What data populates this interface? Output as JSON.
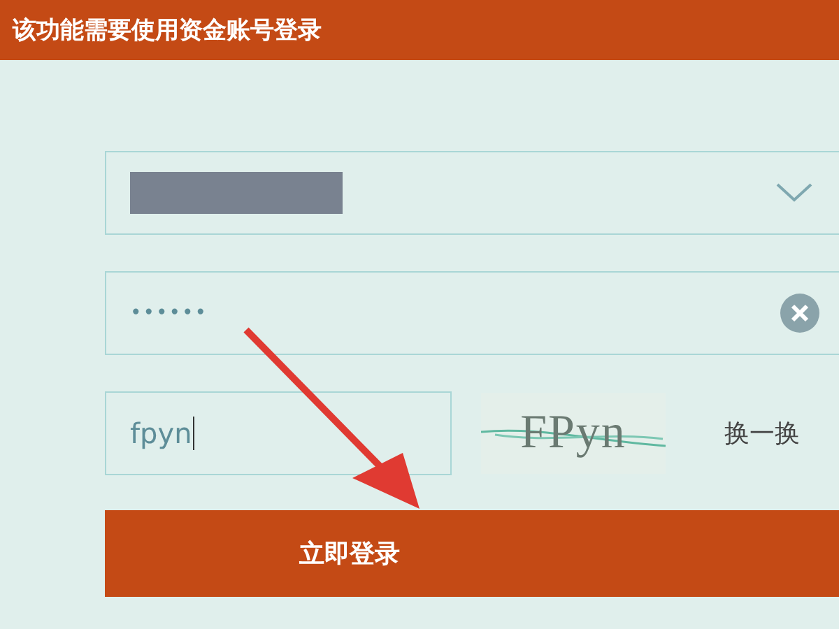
{
  "header": {
    "title": "该功能需要使用资金账号登录"
  },
  "account_field": {
    "redacted": true
  },
  "password_field": {
    "value": "••••••"
  },
  "captcha_field": {
    "value": "fpyn",
    "focused": true
  },
  "captcha_image": {
    "text": "FPyn"
  },
  "refresh_link": {
    "label": "换一换"
  },
  "login_button": {
    "label": "立即登录"
  },
  "annotation_arrow": {
    "shown": true
  }
}
